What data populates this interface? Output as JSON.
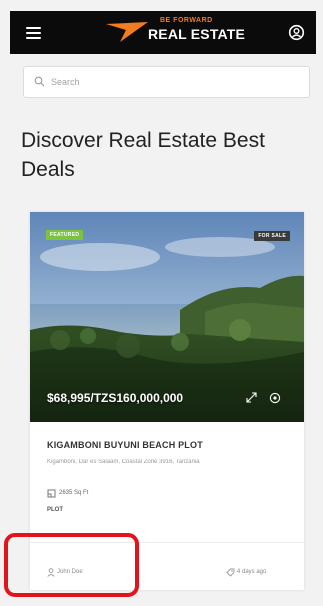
{
  "header": {
    "logo_small_text": "BE FORWARD",
    "logo_main_text": "REAL ESTATE",
    "icons": [
      "menu-icon",
      "account-icon"
    ]
  },
  "search": {
    "placeholder": "Search",
    "icon": "search-icon"
  },
  "page_title": "Discover Real Estate Best Deals",
  "listing": {
    "badge_featured": "FEATURED",
    "badge_status": "FOR SALE",
    "price": "$68,995/TZS160,000,000",
    "title": "KIGAMBONI BUYUNI BEACH PLOT",
    "address": "Kigamboni, Dar es Salaam, Coastal Zone 3916, Tanzania",
    "area": "2635 Sq Ft",
    "type": "PLOT",
    "agent": "John Doe",
    "posted": "4 days ago",
    "icons": [
      "expand-icon",
      "view-icon",
      "area-icon",
      "user-icon",
      "tag-icon"
    ]
  },
  "colors": {
    "header_bg": "#0b0b0b",
    "brand_orange": "#f37c20",
    "featured_green": "#7cc341",
    "status_dark": "#3a3a3a",
    "highlight_red": "#e4131b"
  }
}
